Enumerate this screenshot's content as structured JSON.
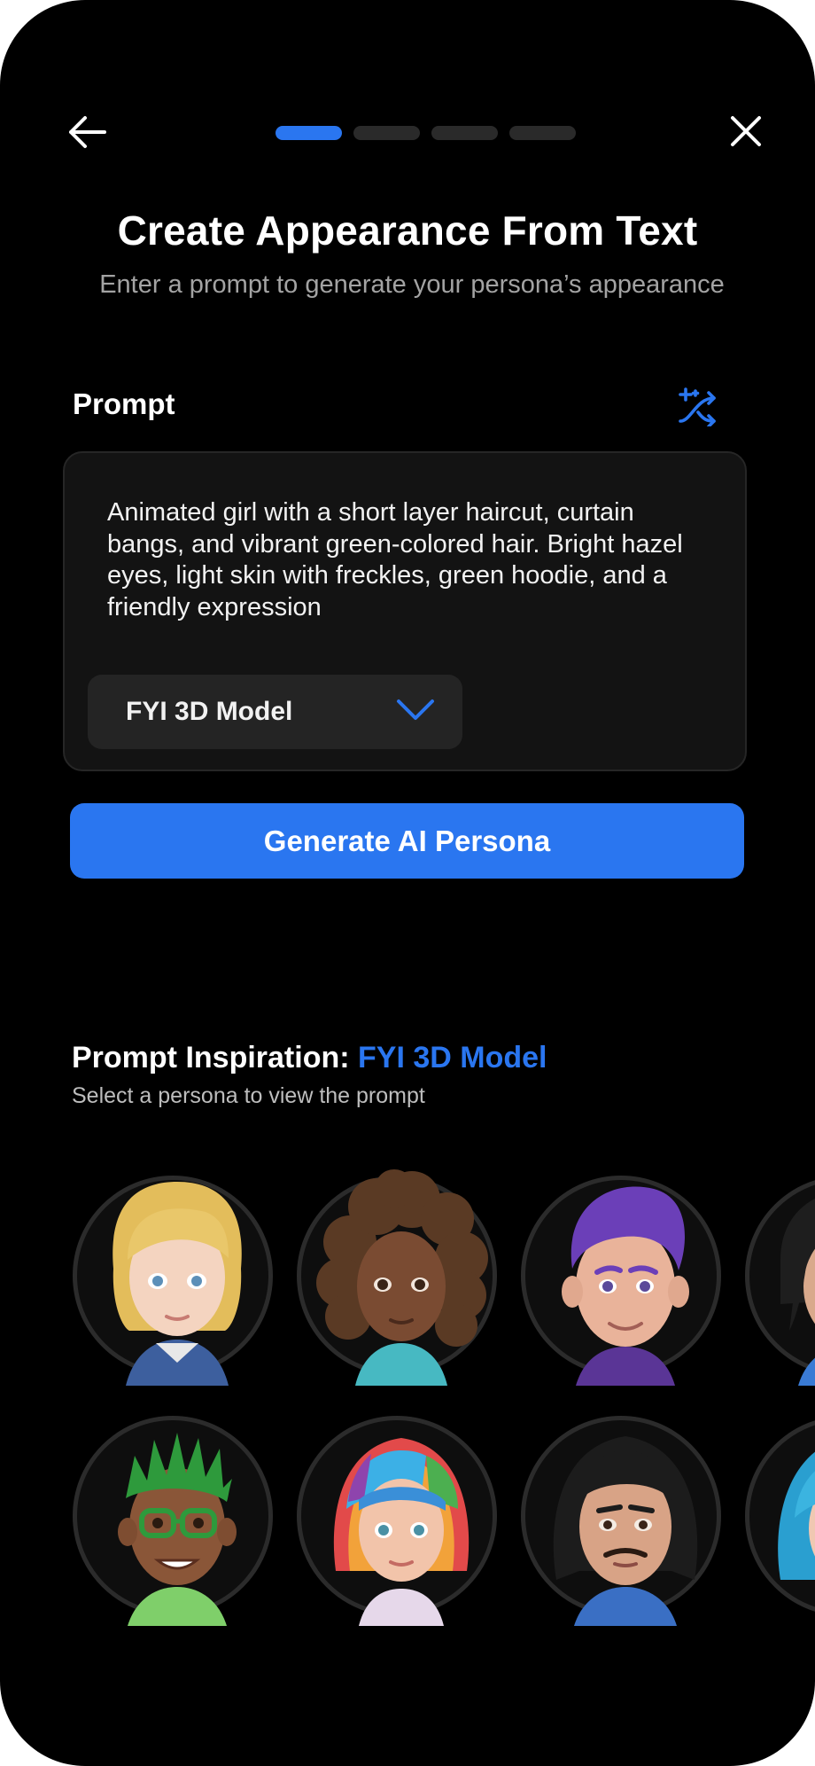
{
  "header": {
    "back_icon": "arrow-left-icon",
    "close_icon": "close-icon",
    "steps": [
      {
        "active": true
      },
      {
        "active": false
      },
      {
        "active": false
      },
      {
        "active": false
      }
    ]
  },
  "title": "Create Appearance From Text",
  "subtitle": "Enter a prompt to generate your persona’s appearance",
  "prompt": {
    "label": "Prompt",
    "shuffle_icon": "shuffle-icon",
    "text": "Animated girl with a short layer haircut, curtain bangs, and vibrant green-colored hair. Bright hazel eyes, light skin with freckles, green hoodie, and a friendly expression",
    "model_select": {
      "value": "FYI 3D Model",
      "icon": "chevron-down-icon"
    }
  },
  "generate_label": "Generate AI Persona",
  "inspiration": {
    "title_prefix": "Prompt Inspiration: ",
    "title_accent": "FYI 3D Model",
    "subtitle": "Select a persona to view the prompt"
  },
  "colors": {
    "accent": "#2a76f0",
    "background": "#000000",
    "surface": "#131313",
    "select_bg": "#242424"
  }
}
